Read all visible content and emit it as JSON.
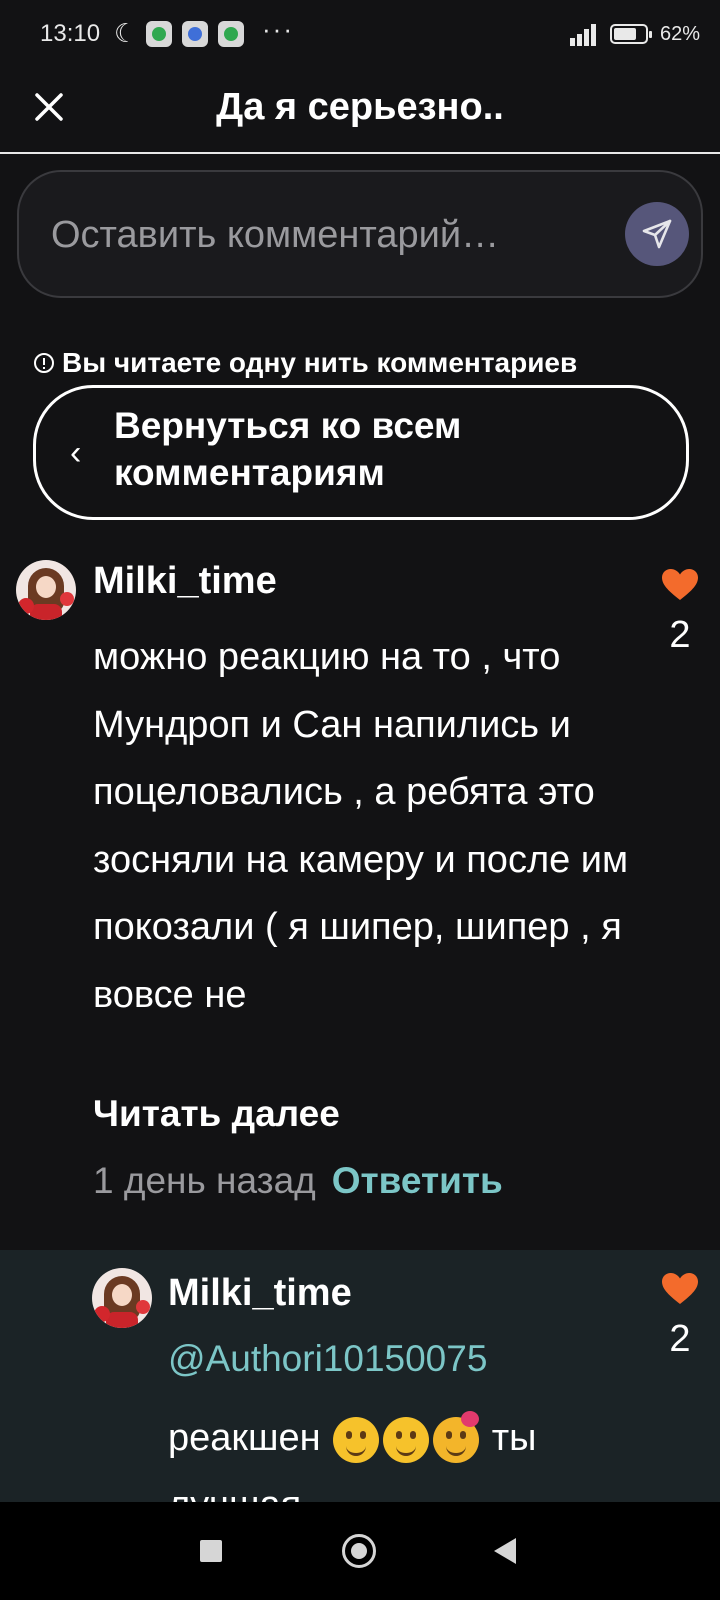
{
  "status_bar": {
    "time": "13:10",
    "more": "···",
    "battery": "62%"
  },
  "header": {
    "title": "Да я серьезно.."
  },
  "comment_input": {
    "placeholder": "Оставить комментарий…"
  },
  "thread": {
    "notice": "Вы читаете одну нить комментариев",
    "back_label": "Вернуться ко всем комментариям"
  },
  "comments": [
    {
      "username": "Milki_time",
      "text": "можно реакцию на то , что Мундроп и Сан напились и поцеловались , а ребята это зосняли на камеру и после им покозали ( я шипер, шипер , я вовсе не",
      "read_more": "Читать далее",
      "time_ago": "1 день назад",
      "reply_label": "Ответить",
      "likes": "2"
    }
  ],
  "reply": {
    "username": "Milki_time",
    "mention": "@Authori10150075",
    "text_start": "реакшен",
    "text_mid": "ты",
    "text_end": "лучшая",
    "likes": "2"
  },
  "colors": {
    "background": "#121214",
    "reply_background": "#1b2326",
    "accent_teal": "#7cc6c7",
    "heart": "#f36b2c",
    "send_button": "#56567a"
  },
  "icons": {
    "close": "close-icon",
    "send": "send-icon",
    "info": "info-icon",
    "back": "chevron-left-icon",
    "like": "heart-icon"
  }
}
